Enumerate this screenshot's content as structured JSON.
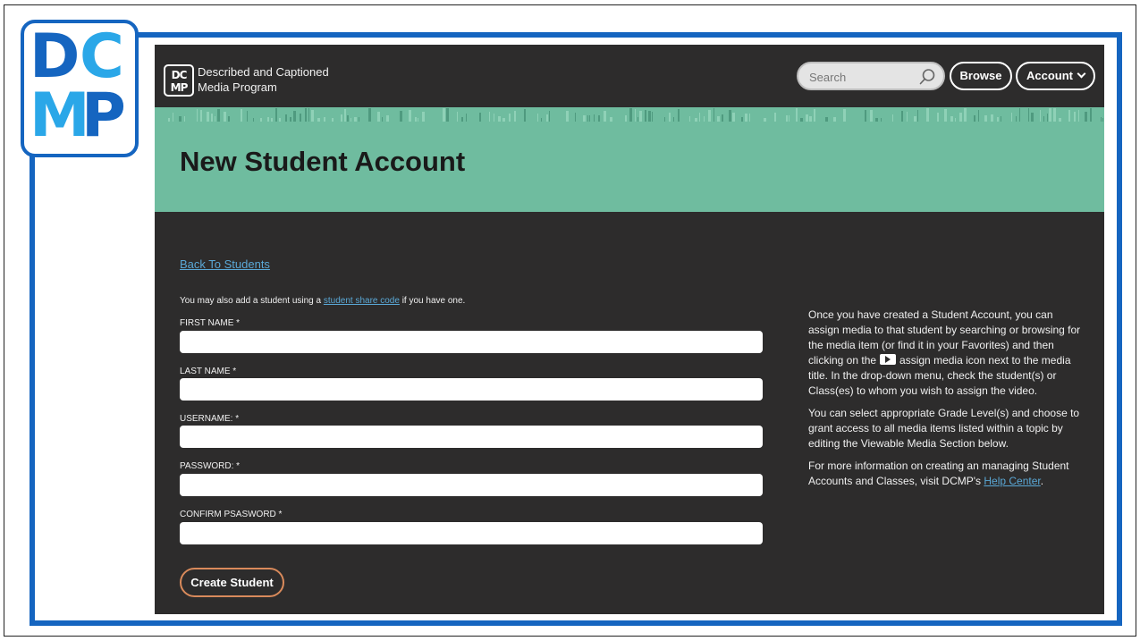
{
  "logo": {
    "letters": [
      "D",
      "C",
      "M",
      "P"
    ]
  },
  "header": {
    "site_logo_text": "DC MP",
    "site_name_line1": "Described and Captioned",
    "site_name_line2": "Media Program",
    "search_placeholder": "Search",
    "browse_label": "Browse",
    "account_label": "Account"
  },
  "banner": {
    "title": "New Student Account"
  },
  "content": {
    "back_link": "Back To Students",
    "share_note_prefix": "You may also add a student using a ",
    "share_note_link": "student share code",
    "share_note_suffix": " if you have one.",
    "fields": [
      {
        "label": "FIRST NAME *",
        "value": ""
      },
      {
        "label": "LAST NAME *",
        "value": ""
      },
      {
        "label": "USERNAME: *",
        "value": ""
      },
      {
        "label": "PASSWORD: *",
        "value": ""
      },
      {
        "label": "CONFIRM PSASWORD *",
        "value": ""
      }
    ],
    "create_button": "Create Student"
  },
  "info": {
    "p1_before_icon": "Once you have created a Student Account, you can assign media to that student by searching or browsing for the media item (or find it in your Favorites) and then clicking on the",
    "p1_after_icon": "assign media icon next to the media title. In the drop-down menu, check the student(s) or Class(es) to whom you wish to assign the video.",
    "p2": "You can select appropriate Grade Level(s) and choose to grant access to all media items listed within a topic by editing the Viewable Media Section below.",
    "p3_prefix": "For more information on creating an managing Student Accounts and Classes, visit DCMP's ",
    "p3_link": "Help Center",
    "p3_suffix": "."
  },
  "colors": {
    "frame_blue": "#1565c0",
    "screen_bg": "#2d2c2c",
    "banner_green": "#6fbc9f",
    "link_blue": "#5aa8d6",
    "button_outline": "#d98a5b"
  }
}
